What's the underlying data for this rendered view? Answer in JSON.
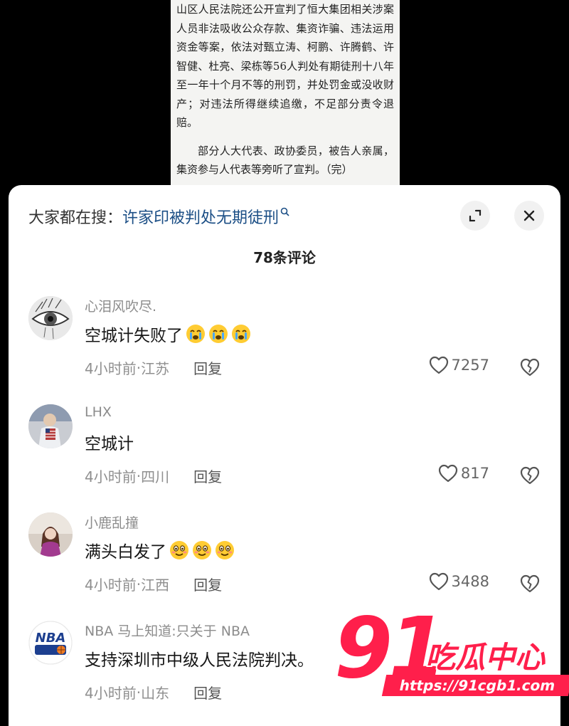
{
  "article": {
    "paragraph_1": "山区人民法院还公开宣判了恒大集团相关涉案人员非法吸收公众存款、集资诈骗、违法运用资金等案，依法对甄立涛、柯鹏、许腾鹤、许智健、杜亮、梁栋等56人判处有期徒刑十八年至一年十个月不等的刑罚，并处罚金或没收财产；对违法所得继续追缴，不足部分责令退赔。",
    "paragraph_2": "部分人大代表、政协委员，被告人亲属，集资参与人代表等旁听了宣判。（完）"
  },
  "sheet": {
    "search_prefix": "大家都在搜：",
    "search_query": "许家印被判处无期徒刑",
    "comment_count": "78条评论",
    "expand_icon": "expand-icon",
    "close_icon": "close-icon"
  },
  "comments": [
    {
      "user": "心泪风吹尽.",
      "text": "空城计失败了",
      "emoji": "crying-face",
      "emoji_count": 3,
      "time": "4小时前",
      "location": "江苏",
      "reply_label": "回复",
      "likes": "7257"
    },
    {
      "user": "LHX",
      "text": "空城计",
      "emoji": "",
      "emoji_count": 0,
      "time": "4小时前",
      "location": "四川",
      "reply_label": "回复",
      "likes": "817"
    },
    {
      "user": "小鹿乱撞",
      "text": "满头白发了",
      "emoji": "flushed-smile",
      "emoji_count": 3,
      "time": "4小时前",
      "location": "江西",
      "reply_label": "回复",
      "likes": "3488"
    },
    {
      "user": "NBA 马上知道:只关于 NBA",
      "text": "支持深圳市中级人民法院判决。",
      "emoji": "",
      "emoji_count": 0,
      "time": "4小时前",
      "location": "山东",
      "reply_label": "回复",
      "likes": ""
    }
  ],
  "separator": " · ",
  "watermark": {
    "number": "91",
    "brand": "吃瓜中心",
    "url": "https://91cgb1.com"
  },
  "colors": {
    "link": "#1c4f86",
    "watermark": "#ff1f4b",
    "muted": "#8f8f8f"
  }
}
